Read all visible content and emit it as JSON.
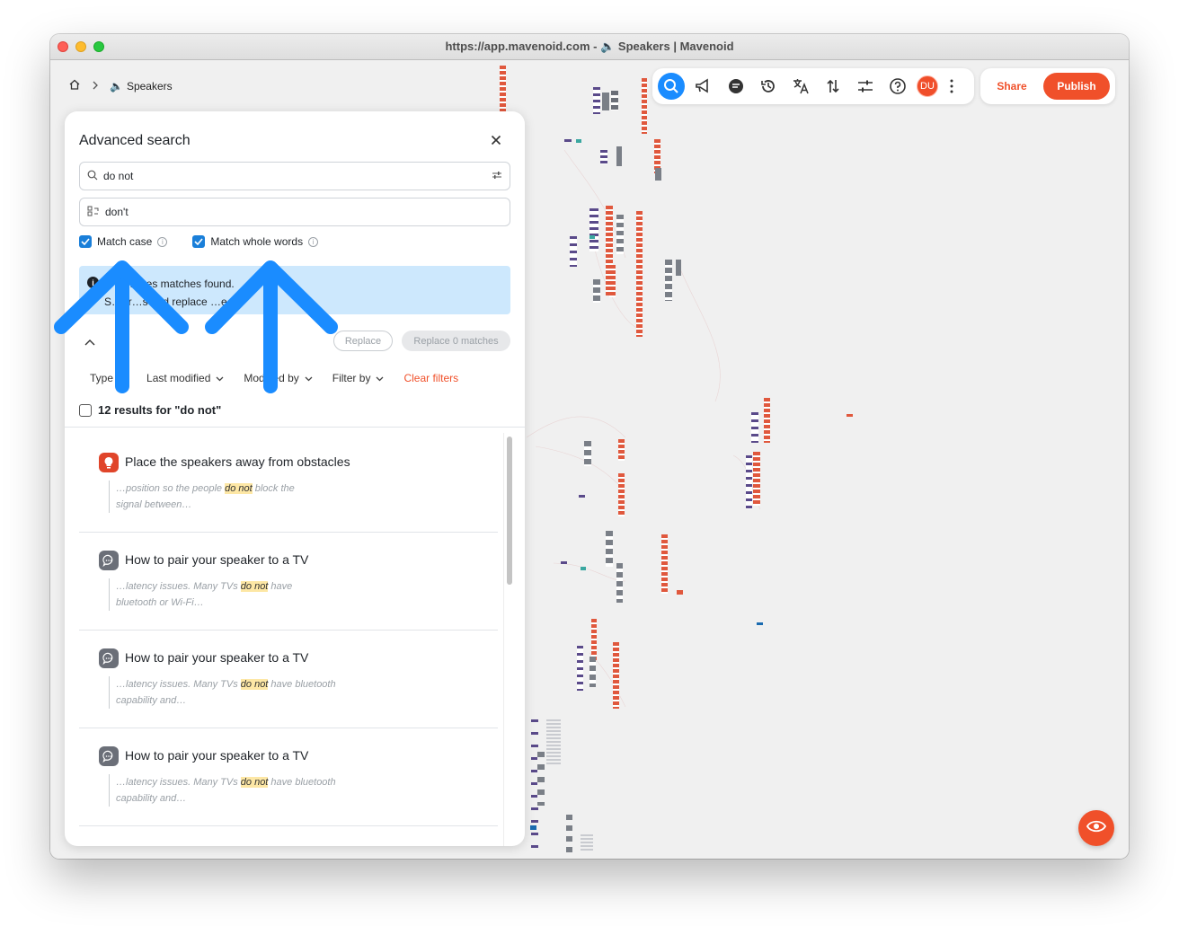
{
  "window": {
    "title": "https://app.mavenoid.com - 🔈 Speakers | Mavenoid"
  },
  "breadcrumb": {
    "home_icon": "home-icon",
    "page": "Speakers"
  },
  "toolbar": {
    "icons": [
      "search-icon",
      "megaphone-icon",
      "chat-icon",
      "history-icon",
      "translate-icon",
      "sort-icon",
      "sliders-icon",
      "help-icon"
    ],
    "avatar": "DU",
    "share": "Share",
    "publish": "Publish"
  },
  "search": {
    "title": "Advanced search",
    "query": "do not",
    "replace": "don't",
    "match_case": "Match case",
    "match_whole_words": "Match whole words",
    "banner_line1": "…hes matches found.",
    "banner_line2": "S…t r…s and replace …e…",
    "replace_btn": "Replace",
    "replace_all_btn": "Replace 0 matches",
    "filters": [
      "Type",
      "Last modified",
      "Modified by",
      "Filter by"
    ],
    "clear_filters": "Clear filters",
    "results_label": "12 results for \"do not\""
  },
  "results": [
    {
      "icon": "lightbulb-icon",
      "title": "Place the speakers away from obstacles",
      "before": "…position so the people ",
      "match": "do not",
      "after": " block the",
      "line2": "signal between…"
    },
    {
      "icon": "chat-bubble-icon",
      "title": "How to pair your speaker to a TV",
      "before": "…latency issues. Many TVs ",
      "match": "do not",
      "after": " have",
      "line2": "bluetooth or Wi-Fi…"
    },
    {
      "icon": "chat-bubble-icon",
      "title": "How to pair your speaker to a TV",
      "before": "…latency issues. Many TVs ",
      "match": "do not",
      "after": " have bluetooth",
      "line2": "capability and…"
    },
    {
      "icon": "chat-bubble-icon",
      "title": "How to pair your speaker to a TV",
      "before": "…latency issues. Many TVs ",
      "match": "do not",
      "after": " have bluetooth",
      "line2": "capability and…"
    }
  ],
  "colors": {
    "accent": "#f0502a",
    "primary": "#1a8cff",
    "banner": "#cde8fd",
    "highlight": "#fde7a5",
    "arrow": "#1a8cff"
  }
}
